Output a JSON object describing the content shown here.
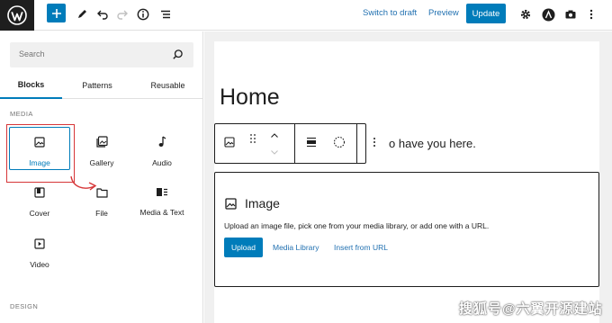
{
  "topbar": {
    "switch_to_draft": "Switch to draft",
    "preview": "Preview",
    "update": "Update"
  },
  "inserter": {
    "search_placeholder": "Search",
    "tabs": [
      {
        "label": "Blocks",
        "active": true
      },
      {
        "label": "Patterns",
        "active": false
      },
      {
        "label": "Reusable",
        "active": false
      }
    ],
    "sections": {
      "media": "MEDIA",
      "design": "DESIGN"
    },
    "blocks": [
      {
        "label": "Image",
        "icon": "image-icon",
        "selected": true
      },
      {
        "label": "Gallery",
        "icon": "gallery-icon",
        "selected": false
      },
      {
        "label": "Audio",
        "icon": "audio-icon",
        "selected": false
      },
      {
        "label": "Cover",
        "icon": "cover-icon",
        "selected": false
      },
      {
        "label": "File",
        "icon": "file-icon",
        "selected": false
      },
      {
        "label": "Media & Text",
        "icon": "media-text-icon",
        "selected": false
      },
      {
        "label": "Video",
        "icon": "video-icon",
        "selected": false
      }
    ]
  },
  "editor": {
    "page_title": "Home",
    "paragraph_visible": "o have you here."
  },
  "image_block": {
    "title": "Image",
    "instructions": "Upload an image file, pick one from your media library, or add one with a URL.",
    "upload": "Upload",
    "media_library": "Media Library",
    "insert_from_url": "Insert from URL"
  },
  "watermark": "搜狐号@六翼开源建站",
  "colors": {
    "accent": "#007cba",
    "link": "#2271b1",
    "annotation": "#d63638"
  }
}
